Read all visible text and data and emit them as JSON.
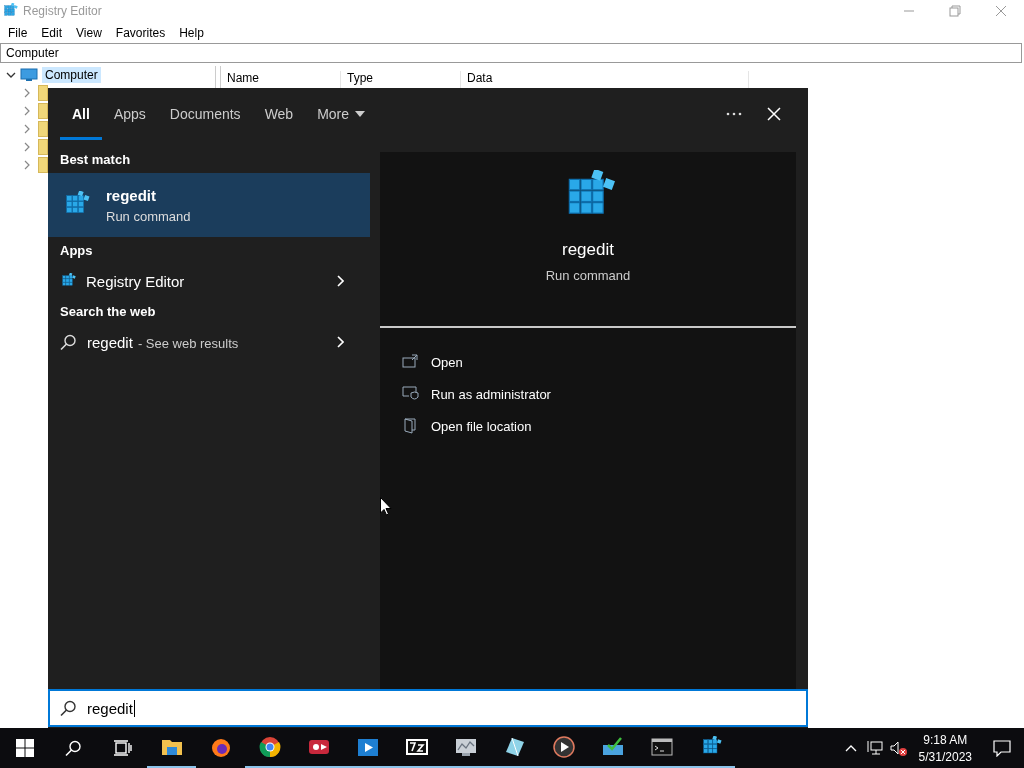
{
  "window": {
    "title": "Registry Editor"
  },
  "menu": [
    "File",
    "Edit",
    "View",
    "Favorites",
    "Help"
  ],
  "address": "Computer",
  "tree": [
    {
      "label": "Computer",
      "expanded": true,
      "selected": true,
      "children": [
        {
          "expanded": false
        },
        {
          "expanded": false
        },
        {
          "expanded": false
        },
        {
          "expanded": false
        },
        {
          "expanded": false
        }
      ]
    }
  ],
  "list_columns": [
    "Name",
    "Type",
    "Data"
  ],
  "search": {
    "tabs": [
      {
        "label": "All",
        "selected": true,
        "kind": "tab"
      },
      {
        "label": "Apps",
        "selected": false,
        "kind": "tab"
      },
      {
        "label": "Documents",
        "selected": false,
        "kind": "tab"
      },
      {
        "label": "Web",
        "selected": false,
        "kind": "tab"
      },
      {
        "label": "More",
        "selected": false,
        "kind": "dropdown"
      }
    ],
    "groups": [
      {
        "heading": "Best match",
        "items": [
          {
            "kind": "best",
            "title": "regedit",
            "subtitle": "Run command",
            "selected": true
          }
        ]
      },
      {
        "heading": "Apps",
        "items": [
          {
            "kind": "app",
            "title": "Registry Editor",
            "selected": false
          }
        ]
      },
      {
        "heading": "Search the web",
        "items": [
          {
            "kind": "web",
            "title": "regedit",
            "suffix": "- See web results",
            "selected": false
          }
        ]
      }
    ],
    "preview": {
      "title": "regedit",
      "subtitle": "Run command"
    },
    "actions": [
      {
        "kind": "open",
        "label": "Open"
      },
      {
        "kind": "admin",
        "label": "Run as administrator"
      },
      {
        "kind": "folder",
        "label": "Open file location"
      }
    ],
    "query": "regedit"
  },
  "taskbar": {
    "apps": [
      {
        "kind": "explorer",
        "running": true
      },
      {
        "kind": "firefox",
        "running": false
      },
      {
        "kind": "chrome",
        "running": true
      },
      {
        "kind": "recorder",
        "running": true
      },
      {
        "kind": "media",
        "running": true
      },
      {
        "kind": "sevenzip",
        "running": true
      },
      {
        "kind": "monitor",
        "running": true
      },
      {
        "kind": "glass",
        "running": true
      },
      {
        "kind": "player",
        "running": true
      },
      {
        "kind": "installer",
        "running": true
      },
      {
        "kind": "console",
        "running": true
      },
      {
        "kind": "regedit",
        "running": true
      }
    ],
    "volume_muted": true,
    "clock": {
      "time": "9:18 AM",
      "date": "5/31/2023"
    }
  }
}
